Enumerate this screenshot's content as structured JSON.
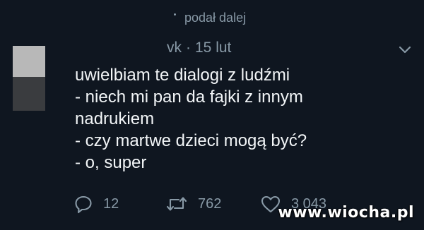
{
  "retweet": {
    "label": "podał dalej"
  },
  "tweet": {
    "handle_fragment": "vk",
    "separator": "·",
    "date": "15 lut",
    "lines": [
      "uwielbiam te dialogi z ludźmi",
      "- niech mi pan da fajki z innym",
      "nadrukiem",
      "- czy martwe dzieci mogą być?",
      "- o, super"
    ]
  },
  "actions": {
    "reply_count": "12",
    "retweet_count": "762",
    "like_count": "3 043"
  },
  "watermark": "www.wiocha.pl",
  "colors": {
    "background": "#0f1620",
    "muted": "#8899a6",
    "text": "#f2f5f7"
  },
  "icons": [
    "retweet-indicator-icon",
    "avatar",
    "chevron-down-icon",
    "reply-icon",
    "retweet-icon",
    "like-icon"
  ]
}
